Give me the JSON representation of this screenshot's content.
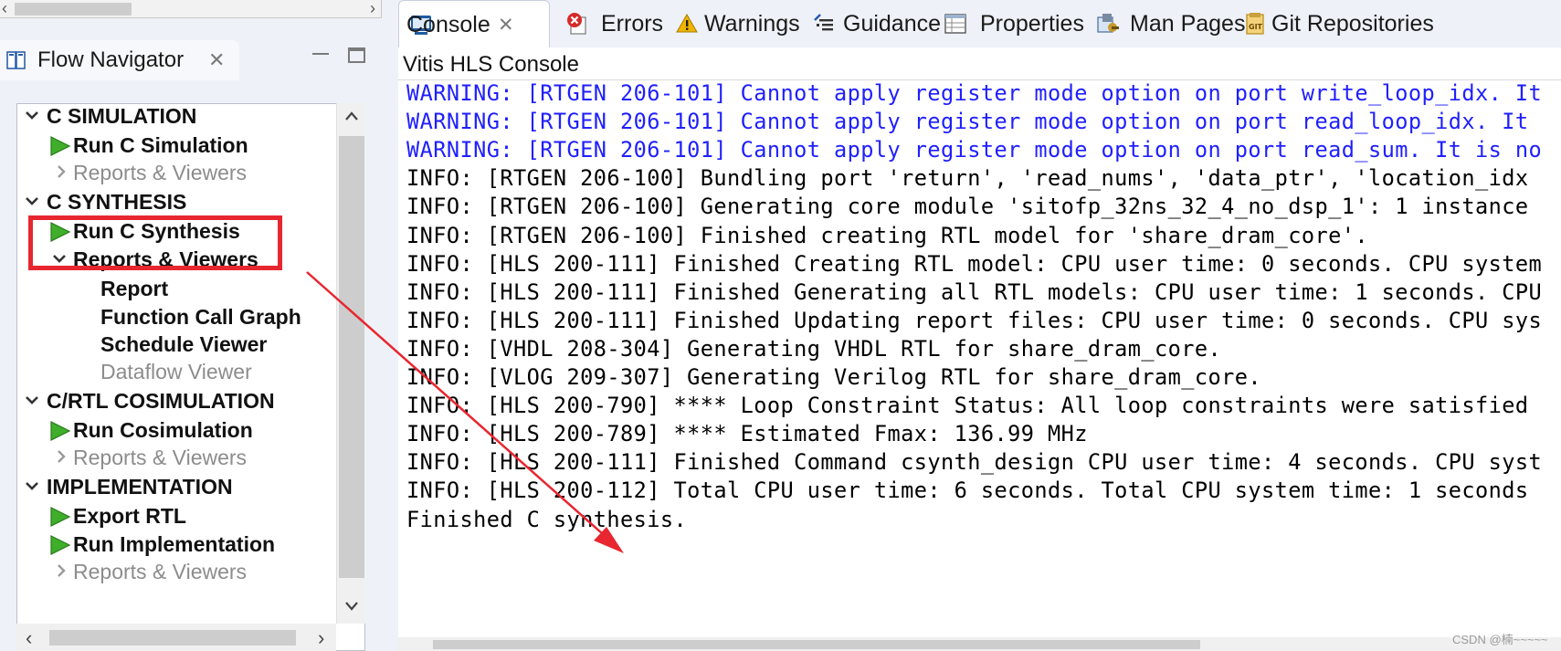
{
  "flow_navigator": {
    "title": "Flow Navigator",
    "tree": [
      {
        "id": "c-simulation",
        "label": "C SIMULATION",
        "kind": "category"
      },
      {
        "id": "run-c-simulation",
        "label": "Run C Simulation",
        "kind": "action"
      },
      {
        "id": "c-sim-reports",
        "label": "Reports & Viewers",
        "kind": "dim"
      },
      {
        "id": "c-synthesis",
        "label": "C SYNTHESIS",
        "kind": "category"
      },
      {
        "id": "run-c-synthesis",
        "label": "Run C Synthesis",
        "kind": "action"
      },
      {
        "id": "c-synth-reports",
        "label": "Reports & Viewers",
        "kind": "sub"
      },
      {
        "id": "report",
        "label": "Report",
        "kind": "leaf"
      },
      {
        "id": "function-call-graph",
        "label": "Function Call Graph",
        "kind": "leaf"
      },
      {
        "id": "schedule-viewer",
        "label": "Schedule Viewer",
        "kind": "leaf"
      },
      {
        "id": "dataflow-viewer",
        "label": "Dataflow Viewer",
        "kind": "dim-leaf"
      },
      {
        "id": "cosimulation",
        "label": "C/RTL COSIMULATION",
        "kind": "category"
      },
      {
        "id": "run-cosimulation",
        "label": "Run Cosimulation",
        "kind": "action"
      },
      {
        "id": "cosim-reports",
        "label": "Reports & Viewers",
        "kind": "dim"
      },
      {
        "id": "implementation",
        "label": "IMPLEMENTATION",
        "kind": "category"
      },
      {
        "id": "export-rtl",
        "label": "Export RTL",
        "kind": "action"
      },
      {
        "id": "run-implementation",
        "label": "Run Implementation",
        "kind": "action"
      },
      {
        "id": "impl-reports",
        "label": "Reports & Viewers",
        "kind": "dim"
      }
    ]
  },
  "tabs": [
    {
      "label": "Console",
      "icon": "console-icon",
      "active": true
    },
    {
      "label": "Errors",
      "icon": "errors-icon"
    },
    {
      "label": "Warnings",
      "icon": "warnings-icon"
    },
    {
      "label": "Guidance",
      "icon": "guidance-icon"
    },
    {
      "label": "Properties",
      "icon": "properties-icon"
    },
    {
      "label": "Man Pages",
      "icon": "man-pages-icon"
    },
    {
      "label": "Git Repositories",
      "icon": "git-repositories-icon"
    }
  ],
  "console": {
    "title": "Vitis HLS Console",
    "lines": [
      {
        "type": "warn",
        "text": "WARNING: [RTGEN 206-101] Cannot apply register mode option on port write_loop_idx. It"
      },
      {
        "type": "warn",
        "text": "WARNING: [RTGEN 206-101] Cannot apply register mode option on port read_loop_idx. It"
      },
      {
        "type": "warn",
        "text": "WARNING: [RTGEN 206-101] Cannot apply register mode option on port read_sum. It is no"
      },
      {
        "type": "info",
        "text": "INFO: [RTGEN 206-100] Bundling port 'return', 'read_nums', 'data_ptr', 'location_idx"
      },
      {
        "type": "info",
        "text": "INFO: [RTGEN 206-100] Generating core module 'sitofp_32ns_32_4_no_dsp_1': 1 instance"
      },
      {
        "type": "info",
        "text": "INFO: [RTGEN 206-100] Finished creating RTL model for 'share_dram_core'."
      },
      {
        "type": "info",
        "text": "INFO: [HLS 200-111] Finished Creating RTL model: CPU user time: 0 seconds. CPU system"
      },
      {
        "type": "info",
        "text": "INFO: [HLS 200-111] Finished Generating all RTL models: CPU user time: 1 seconds. CPU"
      },
      {
        "type": "info",
        "text": "INFO: [HLS 200-111] Finished Updating report files: CPU user time: 0 seconds. CPU sys"
      },
      {
        "type": "info",
        "text": "INFO: [VHDL 208-304] Generating VHDL RTL for share_dram_core."
      },
      {
        "type": "info",
        "text": "INFO: [VLOG 209-307] Generating Verilog RTL for share_dram_core."
      },
      {
        "type": "info",
        "text": "INFO: [HLS 200-790] **** Loop Constraint Status: All loop constraints were satisfied"
      },
      {
        "type": "info",
        "text": "INFO: [HLS 200-789] **** Estimated Fmax: 136.99 MHz"
      },
      {
        "type": "info",
        "text": "INFO: [HLS 200-111] Finished Command csynth_design CPU user time: 4 seconds. CPU syst"
      },
      {
        "type": "info",
        "text": "INFO: [HLS 200-112] Total CPU user time: 6 seconds. Total CPU system time: 1 seconds"
      },
      {
        "type": "info",
        "text": "Finished C synthesis."
      }
    ]
  },
  "watermark": "CSDN @楠~~~~~",
  "colors": {
    "warning_text": "#1f1fff",
    "annotation_red": "#e8262f",
    "play_green": "#3fae2a"
  }
}
